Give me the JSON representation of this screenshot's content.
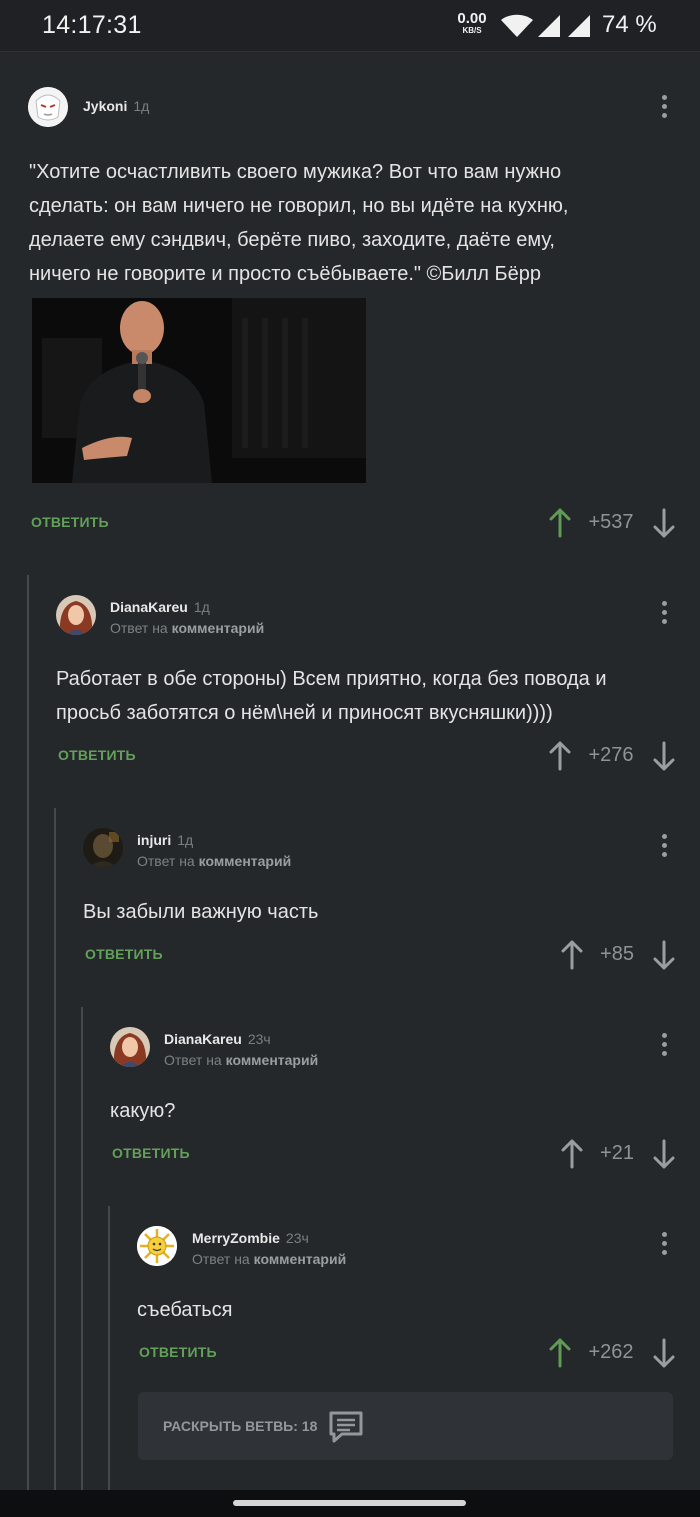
{
  "status": {
    "time": "14:17:31",
    "speed_value": "0.00",
    "speed_unit": "KB/S",
    "battery": "74 %"
  },
  "reply_label": "ОТВЕТИТЬ",
  "reply_note_prefix": "Ответ на",
  "reply_note_target": "комментарий",
  "comments": [
    {
      "user": "Jykoni",
      "ago": "1д",
      "text_lines": [
        "\"Хотите осчастливить своего мужика? Вот что вам нужно",
        "сделать: он вам ничего не говорил, но вы идёте на кухню,",
        "делаете ему сэндвич, берёте пиво, заходите, даёте ему,",
        "ничего не говорите и просто съёбываете.\" ©Билл Бёрр"
      ],
      "score": "+537",
      "upvoted": true
    },
    {
      "user": "DianaKareu",
      "ago": "1д",
      "text_lines": [
        "Работает в обе стороны) Всем приятно, когда без повода и",
        "просьб заботятся о нём\\ней и приносят вкусняшки))))"
      ],
      "score": "+276",
      "upvoted": false
    },
    {
      "user": "injuri",
      "ago": "1д",
      "text_lines": [
        "Вы забыли важную часть"
      ],
      "score": "+85",
      "upvoted": false
    },
    {
      "user": "DianaKareu",
      "ago": "23ч",
      "text_lines": [
        "какую?"
      ],
      "score": "+21",
      "upvoted": false
    },
    {
      "user": "MerryZombie",
      "ago": "23ч",
      "text_lines": [
        "съебаться"
      ],
      "score": "+262",
      "upvoted": true
    }
  ],
  "expand_branch": "РАСКРЫТЬ ВЕТВЬ: 18",
  "colors": {
    "background": "#25282b",
    "upvote_active": "#5f9b55",
    "reply_green": "#63a05a",
    "muted": "#8f9397"
  }
}
